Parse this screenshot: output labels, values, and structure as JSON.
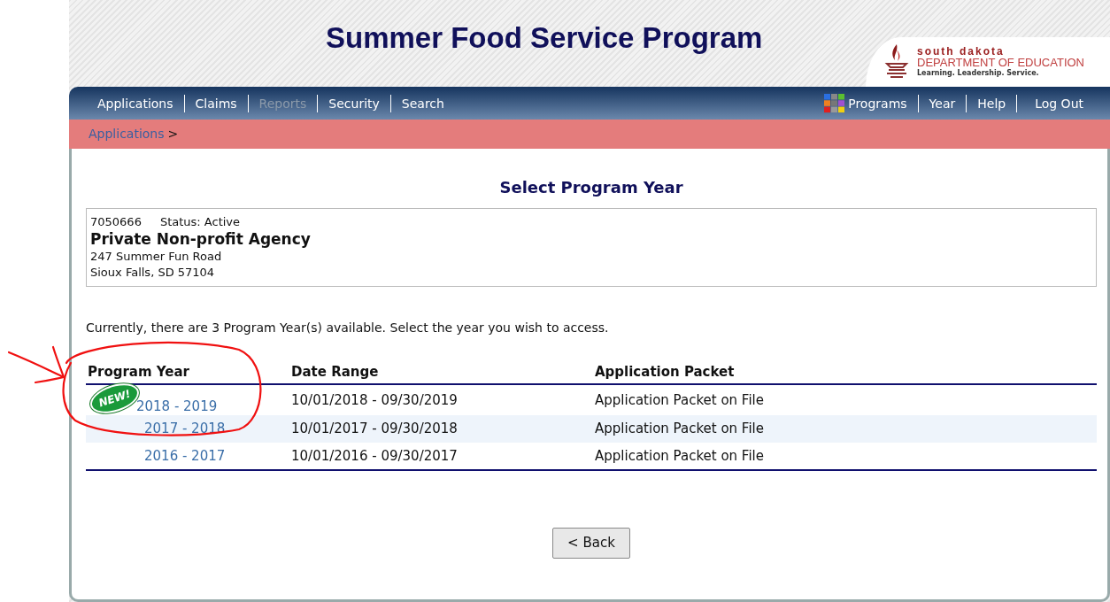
{
  "header": {
    "title": "Summer Food Service Program",
    "logo": {
      "line1": "south dakota",
      "line2": "DEPARTMENT OF EDUCATION",
      "tagline": "Learning. Leadership. Service."
    }
  },
  "nav_left": [
    {
      "label": "Applications",
      "disabled": false
    },
    {
      "label": "Claims",
      "disabled": false
    },
    {
      "label": "Reports",
      "disabled": true
    },
    {
      "label": "Security",
      "disabled": false
    },
    {
      "label": "Search",
      "disabled": false
    }
  ],
  "nav_right": [
    {
      "label": "Programs",
      "kind": "icon"
    },
    {
      "label": "Year",
      "kind": "plain"
    },
    {
      "label": "Help",
      "kind": "plain"
    },
    {
      "label": "Log Out",
      "kind": "plain"
    }
  ],
  "breadcrumb": {
    "link": "Applications",
    "separator": ">"
  },
  "page_title": "Select Program Year",
  "agency": {
    "id": "7050666",
    "status": "Status: Active",
    "name": "Private Non-profit Agency",
    "address1": "247 Summer Fun Road",
    "address2": "Sioux Falls, SD 57104"
  },
  "message": "Currently, there are 3 Program Year(s) available. Select the year you wish to access.",
  "table": {
    "columns": [
      "Program Year",
      "Date Range",
      "Application Packet"
    ],
    "rows": [
      {
        "badge": "NEW!",
        "year": "2018 - 2019",
        "range": "10/01/2018 - 09/30/2019",
        "packet": "Application Packet on File"
      },
      {
        "year": "2017 - 2018",
        "range": "10/01/2017 - 09/30/2018",
        "packet": "Application Packet on File"
      },
      {
        "year": "2016 - 2017",
        "range": "10/01/2016 - 09/30/2017",
        "packet": "Application Packet on File"
      }
    ]
  },
  "back_button": "< Back"
}
